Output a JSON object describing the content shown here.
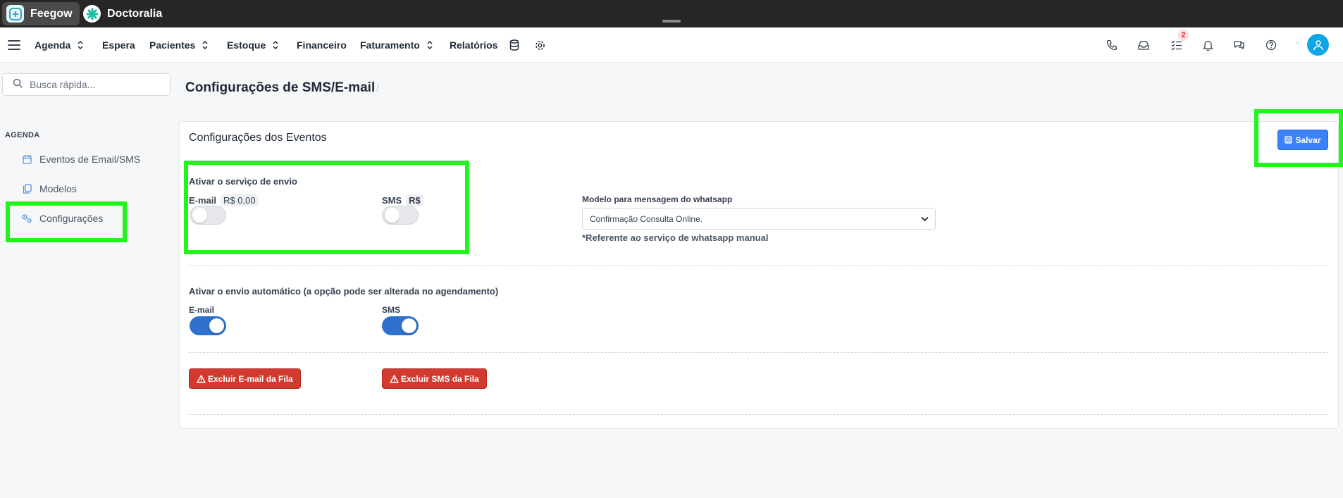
{
  "tabs": [
    {
      "label": "Feegow",
      "active": true,
      "logo_color": "#29a9c8"
    },
    {
      "label": "Doctoralia",
      "active": false,
      "logo_color": "#1dbfa4"
    }
  ],
  "nav": {
    "items": [
      {
        "label": "Agenda",
        "has_chevron": true
      },
      {
        "label": "Espera",
        "has_chevron": false
      },
      {
        "label": "Pacientes",
        "has_chevron": true
      },
      {
        "label": "Estoque",
        "has_chevron": true
      },
      {
        "label": "Financeiro",
        "has_chevron": false
      },
      {
        "label": "Faturamento",
        "has_chevron": true
      },
      {
        "label": "Relatórios",
        "has_chevron": false
      }
    ],
    "tasks_badge": "2",
    "right_icons": [
      "phone-icon",
      "inbox-icon",
      "tasks-icon",
      "bell-icon",
      "chat-icon",
      "help-icon",
      "user-icon"
    ]
  },
  "sidebar": {
    "search_placeholder": "Busca rápida...",
    "section": "AGENDA",
    "items": [
      {
        "label": "Eventos de Email/SMS",
        "icon": "calendar-icon"
      },
      {
        "label": "Modelos",
        "icon": "copy-icon"
      },
      {
        "label": "Configurações",
        "icon": "cogs-icon"
      }
    ]
  },
  "page": {
    "title": "Configurações de SMS/E-mail",
    "breadcrumb_sep": "/"
  },
  "card": {
    "title": "Configurações dos Eventos",
    "save_label": "Salvar",
    "service": {
      "title": "Ativar o serviço de envio",
      "email_label": "E-mail",
      "email_price": "R$ 0,00",
      "email_enabled": false,
      "sms_label": "SMS",
      "sms_price": "R$",
      "sms_enabled": false
    },
    "whatsapp": {
      "label": "Modelo para mensagem do whatsapp",
      "selected": "Confirmação Consulta Online.",
      "note": "*Referente ao serviço de whatsapp manual"
    },
    "auto": {
      "title": "Ativar o envio automático (a opção pode ser alterada no agendamento)",
      "email_label": "E-mail",
      "email_enabled": true,
      "sms_label": "SMS",
      "sms_enabled": true
    },
    "delete_email_label": "Excluir E-mail da Fila",
    "delete_sms_label": "Excluir SMS da Fila"
  },
  "colors": {
    "topbar": "#262626",
    "primary": "#3b82f6",
    "toggle_on": "#2f6fce",
    "danger": "#d33a2f",
    "highlight": "#22f51a"
  }
}
